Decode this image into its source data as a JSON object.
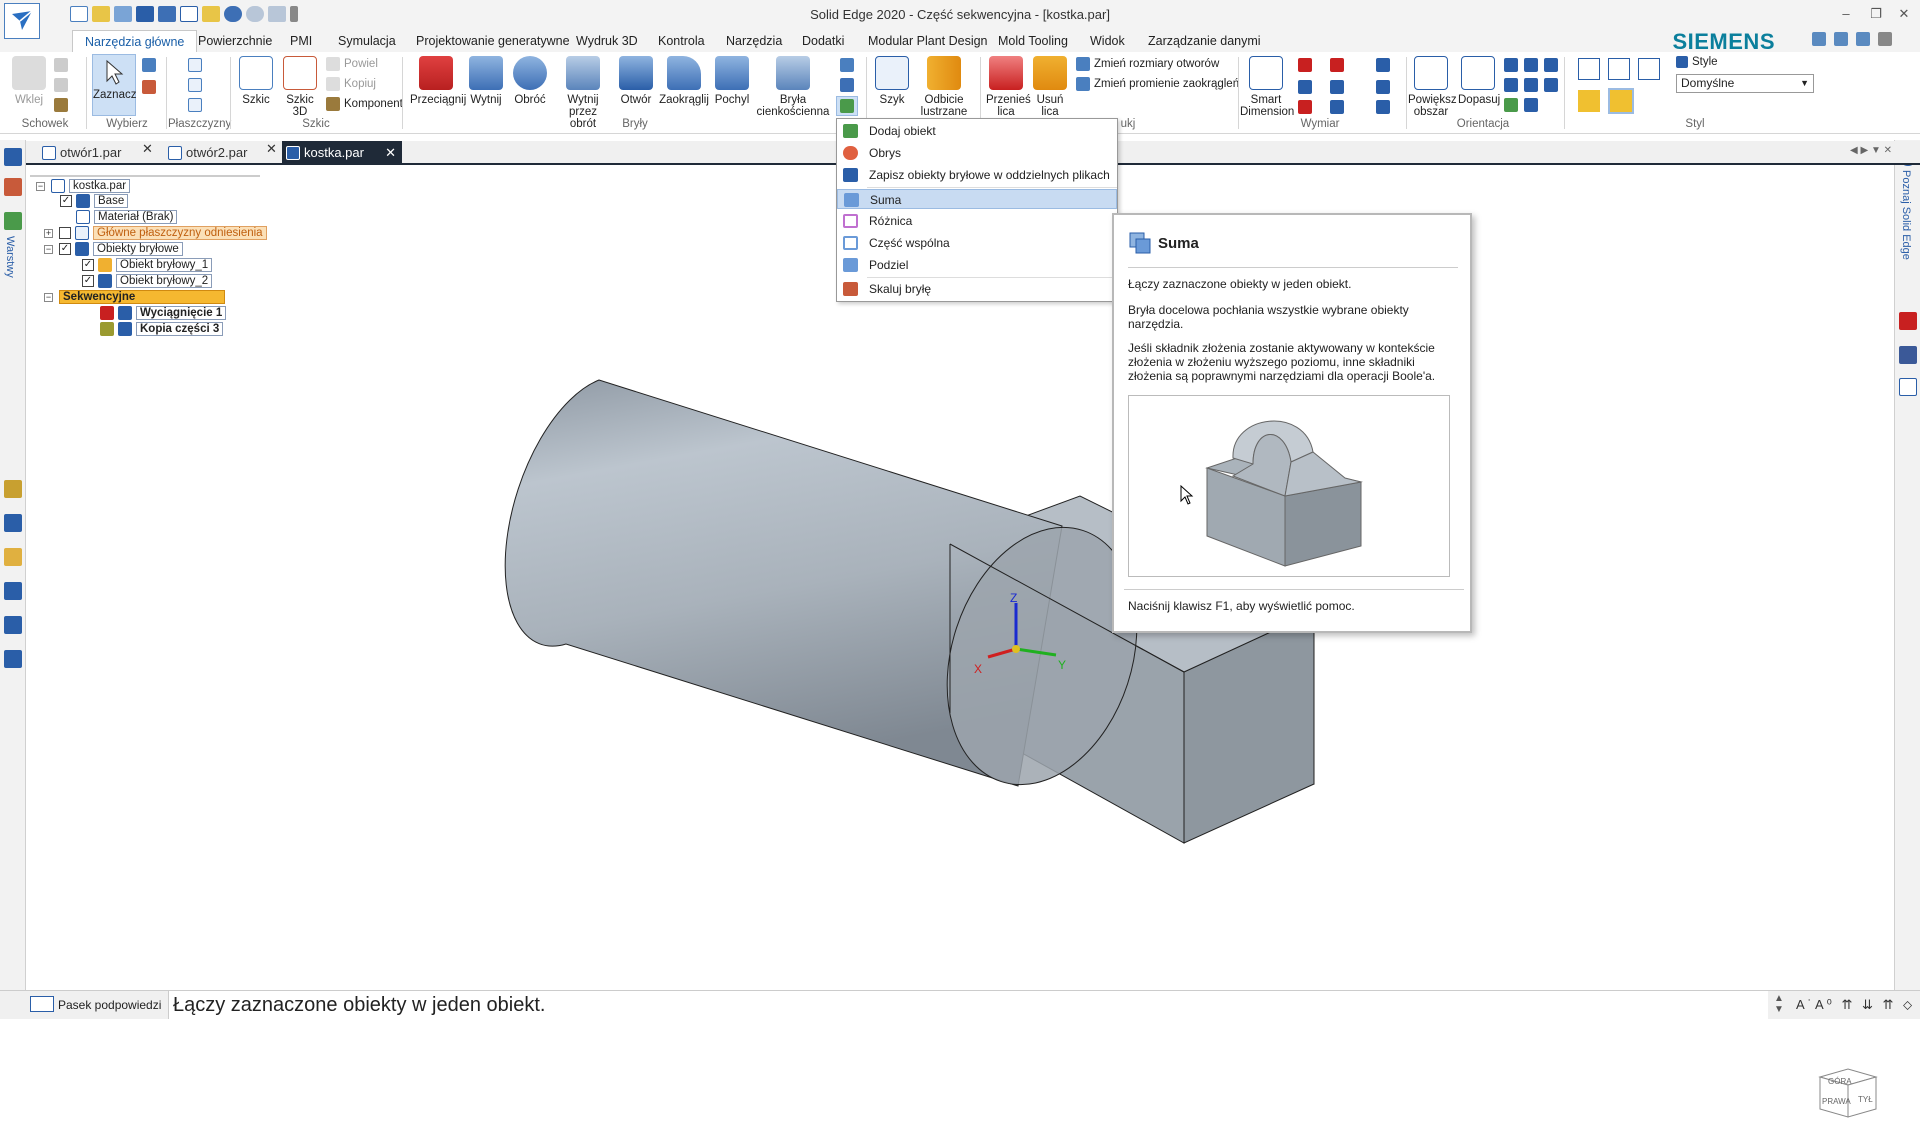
{
  "app": {
    "title": "Solid Edge 2020 - Część sekwencyjna - [kostka.par]",
    "brand": "SIEMENS",
    "accent_color": "#1a5fa8"
  },
  "ribbon_tabs": [
    {
      "label": "Narzędzia główne",
      "active": true
    },
    {
      "label": "Powierzchnie"
    },
    {
      "label": "PMI"
    },
    {
      "label": "Symulacja"
    },
    {
      "label": "Projektowanie generatywne"
    },
    {
      "label": "Wydruk 3D"
    },
    {
      "label": "Kontrola"
    },
    {
      "label": "Narzędzia"
    },
    {
      "label": "Dodatki"
    },
    {
      "label": "Modular Plant Design"
    },
    {
      "label": "Mold Tooling"
    },
    {
      "label": "Widok"
    },
    {
      "label": "Zarządzanie danymi"
    }
  ],
  "ribbon": {
    "schowek": {
      "paste": "Wklej",
      "group": "Schowek"
    },
    "wybierz": {
      "select": "Zaznacz",
      "group": "Wybierz"
    },
    "plaszczyzny": {
      "group": "Płaszczyzny"
    },
    "szkic": {
      "sketch": "Szkic",
      "sketch3d_1": "Szkic",
      "sketch3d_2": "3D",
      "project": "Powiel",
      "copy": "Kopiuj",
      "component": "Komponent",
      "group": "Szkic"
    },
    "bryly": {
      "extrude": "Przeciągnij",
      "cut": "Wytnij",
      "revolve": "Obróć",
      "revcut_1": "Wytnij przez",
      "revcut_2": "obrót",
      "hole": "Otwór",
      "round": "Zaokrąglij",
      "draft": "Pochyl",
      "thin_1": "Bryła",
      "thin_2": "cienkościenna",
      "group": "Bryły"
    },
    "wzorce": {
      "pattern": "Szyk",
      "mirror_1": "Odbicie",
      "mirror_2": "lustrzane"
    },
    "bezposrednie": {
      "move_1": "Przenieś",
      "move_2": "lica",
      "delete_1": "Usuń",
      "delete_2": "lica",
      "resize_holes": "Zmień rozmiary otworów",
      "resize_rounds": "Zmień promienie zaokrągleń",
      "group_tail": "ukj"
    },
    "wymiar": {
      "smart_1": "Smart",
      "smart_2": "Dimension",
      "group": "Wymiar"
    },
    "orientacja": {
      "zoom_1": "Powiększ",
      "zoom_2": "obszar",
      "fit": "Dopasuj",
      "group": "Orientacja"
    },
    "styl": {
      "label": "Style",
      "value": "Domyślne",
      "group": "Styl"
    }
  },
  "doc_tabs": [
    {
      "label": "otwór1.par",
      "active": false
    },
    {
      "label": "otwór2.par",
      "active": false
    },
    {
      "label": "kostka.par",
      "active": true
    }
  ],
  "tree": {
    "root": "kostka.par",
    "base": "Base",
    "material": "Materiał (Brak)",
    "planes": "Główne płaszczyzny odniesienia",
    "bodies": "Obiekty bryłowe",
    "body1": "Obiekt bryłowy_1",
    "body2": "Obiekt bryłowy_2",
    "sequential": "Sekwencyjne",
    "feat1": "Wyciągnięcie 1",
    "feat2": "Kopia części 3"
  },
  "menu": {
    "items": [
      {
        "label": "Dodaj obiekt",
        "icon": "add-body-icon"
      },
      {
        "label": "Obrys",
        "icon": "outline-icon"
      },
      {
        "label": "Zapisz obiekty bryłowe w oddzielnych plikach",
        "icon": "save-bodies-icon"
      },
      {
        "label": "Suma",
        "icon": "union-icon",
        "highlighted": true
      },
      {
        "label": "Różnica",
        "icon": "subtract-icon"
      },
      {
        "label": "Część wspólna",
        "icon": "intersect-icon"
      },
      {
        "label": "Podziel",
        "icon": "split-icon"
      },
      {
        "label": "Skaluj bryłę",
        "icon": "scale-body-icon"
      }
    ]
  },
  "tooltip": {
    "title": "Suma",
    "line1": "Łączy zaznaczone obiekty w jeden obiekt.",
    "line2": "Bryła docelowa pochłania wszystkie wybrane obiekty narzędzia.",
    "line3": "Jeśli składnik złożenia zostanie aktywowany w kontekście złożenia w złożeniu wyższego poziomu, inne składniki złożenia są poprawnymi narzędziami dla operacji Boole'a.",
    "help": "Naciśnij klawisz F1, aby wyświetlić pomoc."
  },
  "left_panel": {
    "label": "Warstwy"
  },
  "right_panel": {
    "label": "Poznaj Solid Edge"
  },
  "viewport": {
    "axis_x": "X",
    "axis_y": "Y",
    "axis_z": "Z",
    "cube_front": "PRAWA",
    "cube_top": "GÓRA",
    "cube_right": "TYŁ"
  },
  "statusbar": {
    "label": "Pasek podpowiedzi",
    "prompt": "Łączy zaznaczone obiekty w jeden obiekt."
  }
}
